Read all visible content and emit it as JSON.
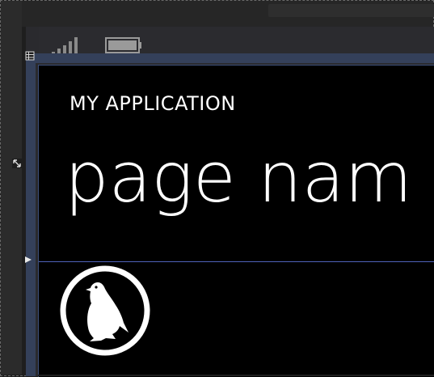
{
  "app": {
    "title": "MY APPLICATION",
    "page_name": "page nam"
  },
  "status_bar": {
    "signal_icon": "signal-strength-icon",
    "battery_icon": "battery-icon"
  },
  "designer": {
    "ruler_corner_icon": "grid-icon",
    "resize_icon": "resize-icon",
    "guide_marker_icon": "guide-arrow-icon"
  },
  "content": {
    "logo_icon": "penguin-logo-icon"
  },
  "colors": {
    "screen_background": "#000000",
    "text": "#ffffff",
    "ruler": "#34405a",
    "guide": "#4f62b8"
  }
}
